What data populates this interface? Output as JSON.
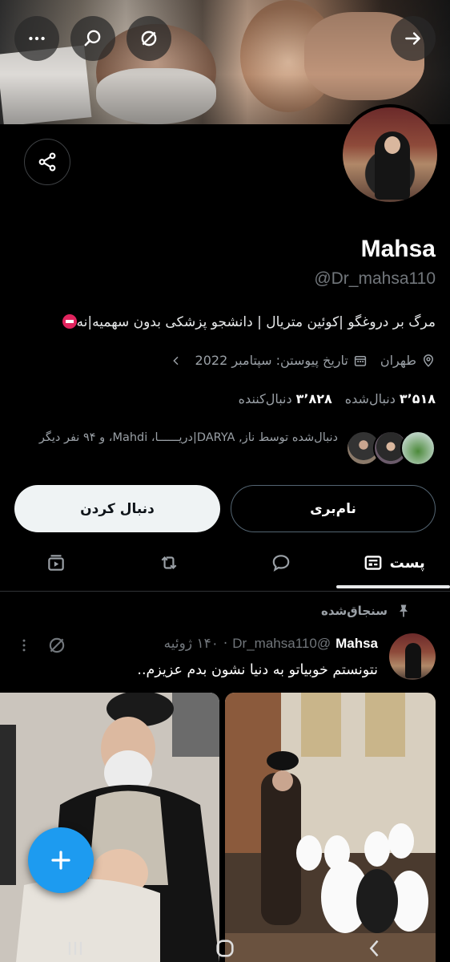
{
  "profile": {
    "name": "Mahsa",
    "handle": "@Dr_mahsa110",
    "bio": "مرگ بر دروغگو |کوئین متریال | دانشجو پزشکی بدون سهمیه|نه",
    "bio_emoji": "no-entry-icon",
    "location": "طهران",
    "joined": "تاریخ پیوستن: سپتامبر 2022",
    "following_count": "۳٬۵۱۸",
    "following_label": "دنبال‌شده",
    "followers_count": "۳٬۸۲۸",
    "followers_label": "دنبال‌کننده",
    "followed_by_text": "دنبال‌شده توسط ناز, DARYA|دریــــــا، Mahdi، و ۹۴ نفر دیگر"
  },
  "actions": {
    "follow_label": "دنبال کردن",
    "notify_label": "نام‌بری"
  },
  "tabs": [
    {
      "label": "پست",
      "icon": "posts-icon",
      "active": true
    },
    {
      "label": "",
      "icon": "replies-icon"
    },
    {
      "label": "",
      "icon": "retweet-icon"
    },
    {
      "label": "",
      "icon": "media-icon"
    }
  ],
  "post": {
    "pinned_label": "سنجاق‌شده",
    "author": "Mahsa",
    "handle": "@Dr_mahsa110",
    "separator": "·",
    "date": "۱۴۰ ژوئیه",
    "text": "نتونستم خوبیاتو به دنیا نشون بدم عزیزم.."
  },
  "colors": {
    "background": "#000000",
    "accent": "#1d9bf0",
    "muted": "#71767b",
    "text": "#e7e9ea"
  }
}
